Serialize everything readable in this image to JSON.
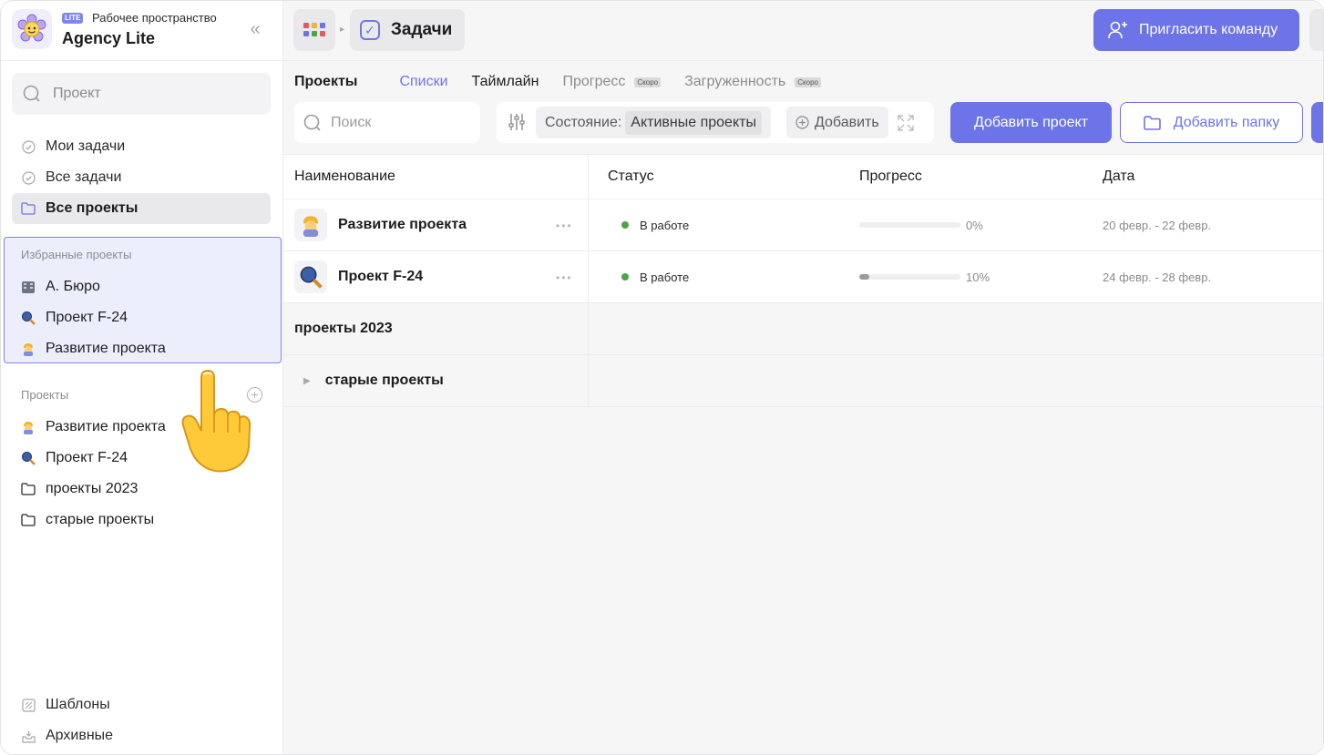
{
  "workspace": {
    "badge": "LITE",
    "subtitle": "Рабочее пространство",
    "name": "Agency Lite"
  },
  "sidebar": {
    "search_placeholder": "Проект",
    "nav": [
      {
        "label": "Мои задачи"
      },
      {
        "label": "Все задачи"
      },
      {
        "label": "Все проекты"
      }
    ],
    "favorites_label": "Избранные проекты",
    "favorites": [
      {
        "label": "А. Бюро"
      },
      {
        "label": "Проект F-24"
      },
      {
        "label": "Развитие проекта"
      }
    ],
    "projects_label": "Проекты",
    "projects": [
      {
        "label": "Развитие проекта"
      },
      {
        "label": "Проект F-24"
      },
      {
        "label": "проекты 2023"
      },
      {
        "label": "старые проекты"
      }
    ],
    "bottom": [
      {
        "label": "Шаблоны"
      },
      {
        "label": "Архивные"
      }
    ]
  },
  "topbar": {
    "breadcrumb": "Задачи",
    "invite_label": "Пригласить команду"
  },
  "tabs": {
    "title": "Проекты",
    "items": [
      {
        "label": "Списки"
      },
      {
        "label": "Таймлайн"
      },
      {
        "label": "Прогресс",
        "badge": "Скоро"
      },
      {
        "label": "Загруженность",
        "badge": "Скоро"
      }
    ]
  },
  "toolbar": {
    "search_placeholder": "Поиск",
    "state_label": "Состояние:",
    "state_value": "Активные проекты",
    "add_filter_label": "Добавить",
    "add_project_label": "Добавить проект",
    "add_folder_label": "Добавить папку"
  },
  "table": {
    "columns": [
      "Наименование",
      "Статус",
      "Прогресс",
      "Дата"
    ],
    "rows": [
      {
        "name": "Развитие проекта",
        "status": "В работе",
        "progress": 0,
        "progress_label": "0%",
        "date": "20 февр. - 22 февр."
      },
      {
        "name": "Проект F-24",
        "status": "В работе",
        "progress": 10,
        "progress_label": "10%",
        "date": "24 февр. - 28 февр."
      }
    ],
    "groups": [
      {
        "label": "проекты 2023"
      },
      {
        "label": "старые проекты"
      }
    ]
  },
  "colors": {
    "accent": "#6c74e7",
    "status_active": "#4aa549",
    "favorites_highlight": "#eceefc"
  }
}
